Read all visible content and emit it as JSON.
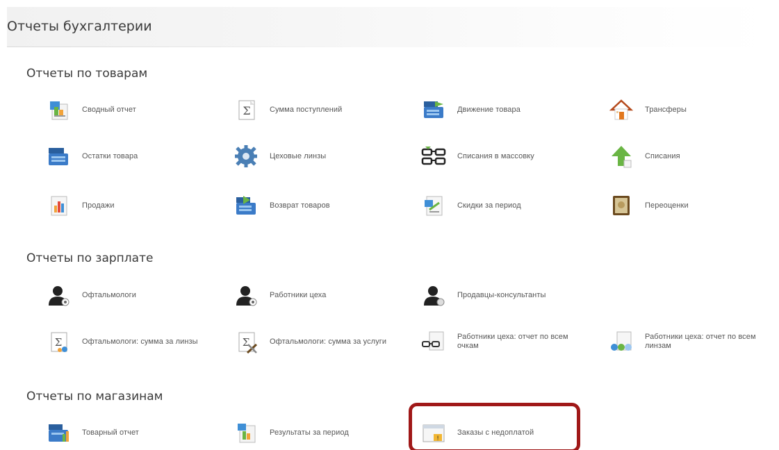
{
  "header": {
    "title": "Отчеты бухгалтерии"
  },
  "sections": {
    "goods": {
      "title": "Отчеты по товарам",
      "items": [
        {
          "label": "Сводный отчет",
          "icon": "summary-report-icon"
        },
        {
          "label": "Сумма поступлений",
          "icon": "sigma-document-icon"
        },
        {
          "label": "Движение товара",
          "icon": "cash-register-move-icon"
        },
        {
          "label": "Трансферы",
          "icon": "house-icon"
        },
        {
          "label": "Остатки товара",
          "icon": "cash-register-icon"
        },
        {
          "label": "Цеховые линзы",
          "icon": "gear-icon"
        },
        {
          "label": "Списания в массовку",
          "icon": "glasses-icon"
        },
        {
          "label": "Списания",
          "icon": "arrow-up-icon"
        },
        {
          "label": "Продажи",
          "icon": "bar-chart-icon"
        },
        {
          "label": "Возврат товаров",
          "icon": "cash-register-return-icon"
        },
        {
          "label": "Скидки за период",
          "icon": "discount-document-icon"
        },
        {
          "label": "Переоценки",
          "icon": "price-book-icon"
        }
      ]
    },
    "salary": {
      "title": "Отчеты по зарплате",
      "items": [
        {
          "label": "Офтальмологи",
          "icon": "user-icon"
        },
        {
          "label": "Работники цеха",
          "icon": "user-icon"
        },
        {
          "label": "Продавцы-консультанты",
          "icon": "user-icon"
        },
        {
          "label": "Офтальмологи: сумма за линзы",
          "icon": "sigma-lens-icon"
        },
        {
          "label": "Офтальмологи: сумма за услуги",
          "icon": "sigma-tools-icon"
        },
        {
          "label": "Работники цеха: отчет по всем очкам",
          "icon": "glasses-document-icon"
        },
        {
          "label": "Работники цеха: отчет по всем линзам",
          "icon": "lenses-document-icon"
        }
      ]
    },
    "stores": {
      "title": "Отчеты по магазинам",
      "items": [
        {
          "label": "Товарный отчет",
          "icon": "goods-report-icon"
        },
        {
          "label": "Результаты за период",
          "icon": "period-results-icon"
        },
        {
          "label": "Заказы с недоплатой",
          "icon": "unpaid-orders-icon"
        }
      ]
    }
  },
  "colors": {
    "highlight": "#a01818",
    "heading": "#3a3a3a",
    "label": "#555555"
  }
}
